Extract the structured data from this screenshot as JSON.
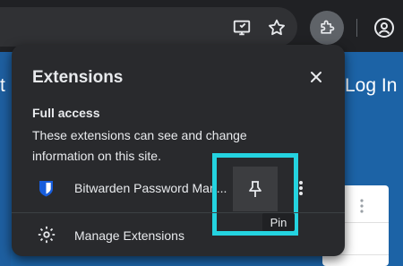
{
  "page": {
    "left_text": "t",
    "login_link": "Log In"
  },
  "toolbar": {
    "icons": [
      "cast-icon",
      "star-icon",
      "extensions-puzzle-icon",
      "profile-icon"
    ]
  },
  "popup": {
    "title": "Extensions",
    "section": {
      "heading": "Full access",
      "description": "These extensions can see and change information on this site."
    },
    "extensions": [
      {
        "name": "Bitwarden Password Man...",
        "icon": "bitwarden-icon"
      }
    ],
    "pin_tooltip": "Pin",
    "manage_label": "Manage Extensions"
  },
  "colors": {
    "highlight": "#24d3e0",
    "popup_bg": "#292a2d",
    "page_bg": "#1c63a6",
    "bitwarden_blue": "#175ddc"
  }
}
